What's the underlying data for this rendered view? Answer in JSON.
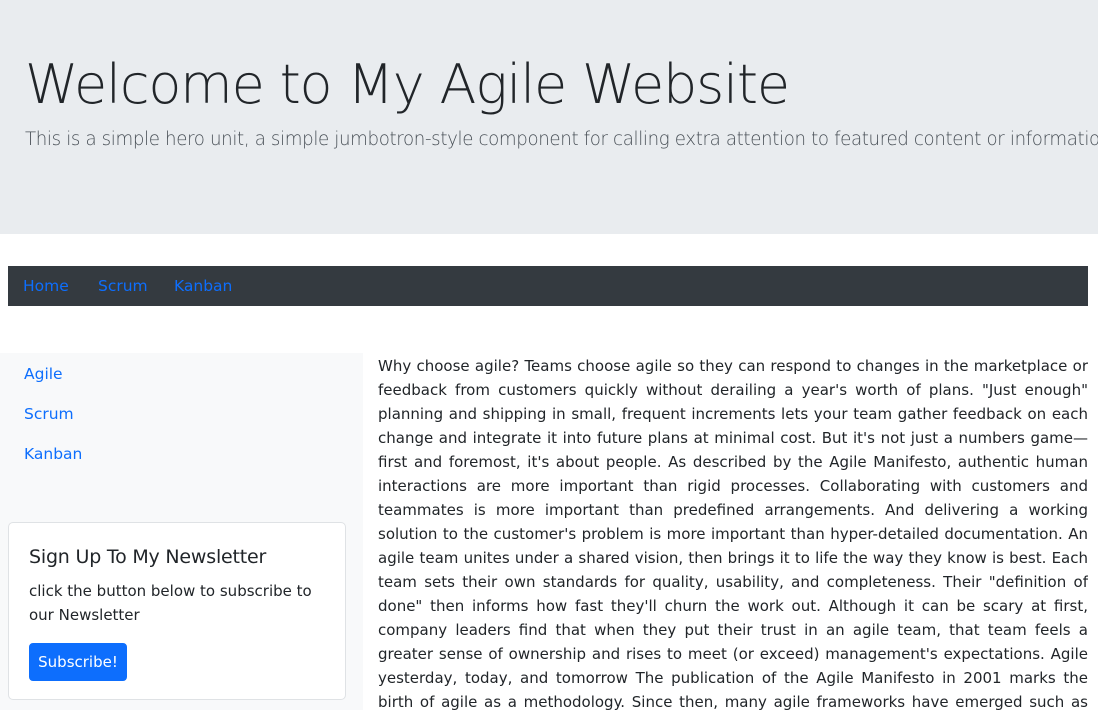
{
  "hero": {
    "title": "Welcome to My Agile Website",
    "lead": "This is a simple hero unit, a simple jumbotron-style component for calling extra attention to featured content or information."
  },
  "topnav": {
    "items": [
      {
        "label": "Home"
      },
      {
        "label": "Scrum"
      },
      {
        "label": "Kanban"
      }
    ]
  },
  "sidebar": {
    "items": [
      {
        "label": "Agile"
      },
      {
        "label": "Scrum"
      },
      {
        "label": "Kanban"
      }
    ]
  },
  "newsletter": {
    "title": "Sign Up To My Newsletter",
    "text": "click the button below to subscribe to our Newsletter",
    "button_label": "Subscribe!"
  },
  "main": {
    "body": "Why choose agile? Teams choose agile so they can respond to changes in the marketplace or feedback from customers quickly without derailing a year's worth of plans. \"Just enough\" planning and shipping in small, frequent increments lets your team gather feedback on each change and integrate it into future plans at minimal cost. But it's not just a numbers game—first and foremost, it's about people. As described by the Agile Manifesto, authentic human interactions are more important than rigid processes. Collaborating with customers and teammates is more important than predefined arrangements. And delivering a working solution to the customer's problem is more important than hyper-detailed documentation. An agile team unites under a shared vision, then brings it to life the way they know is best. Each team sets their own standards for quality, usability, and completeness. Their \"definition of done\" then informs how fast they'll churn the work out. Although it can be scary at first, company leaders find that when they put their trust in an agile team, that team feels a greater sense of ownership and rises to meet (or exceed) management's expectations. Agile yesterday, today, and tomorrow The publication of the Agile Manifesto in 2001 marks the birth of agile as a methodology. Since then, many agile frameworks have emerged such as Scrum, Kanban, Lean, and Extreme Programming (XP). Each embodies the core principles of frequent"
  },
  "colors": {
    "hero_bg": "#e9ecef",
    "nav_bg": "#343a40",
    "link": "#0d6efd",
    "sidebar_bg": "#f8f9fa",
    "button_bg": "#0d6efd"
  }
}
